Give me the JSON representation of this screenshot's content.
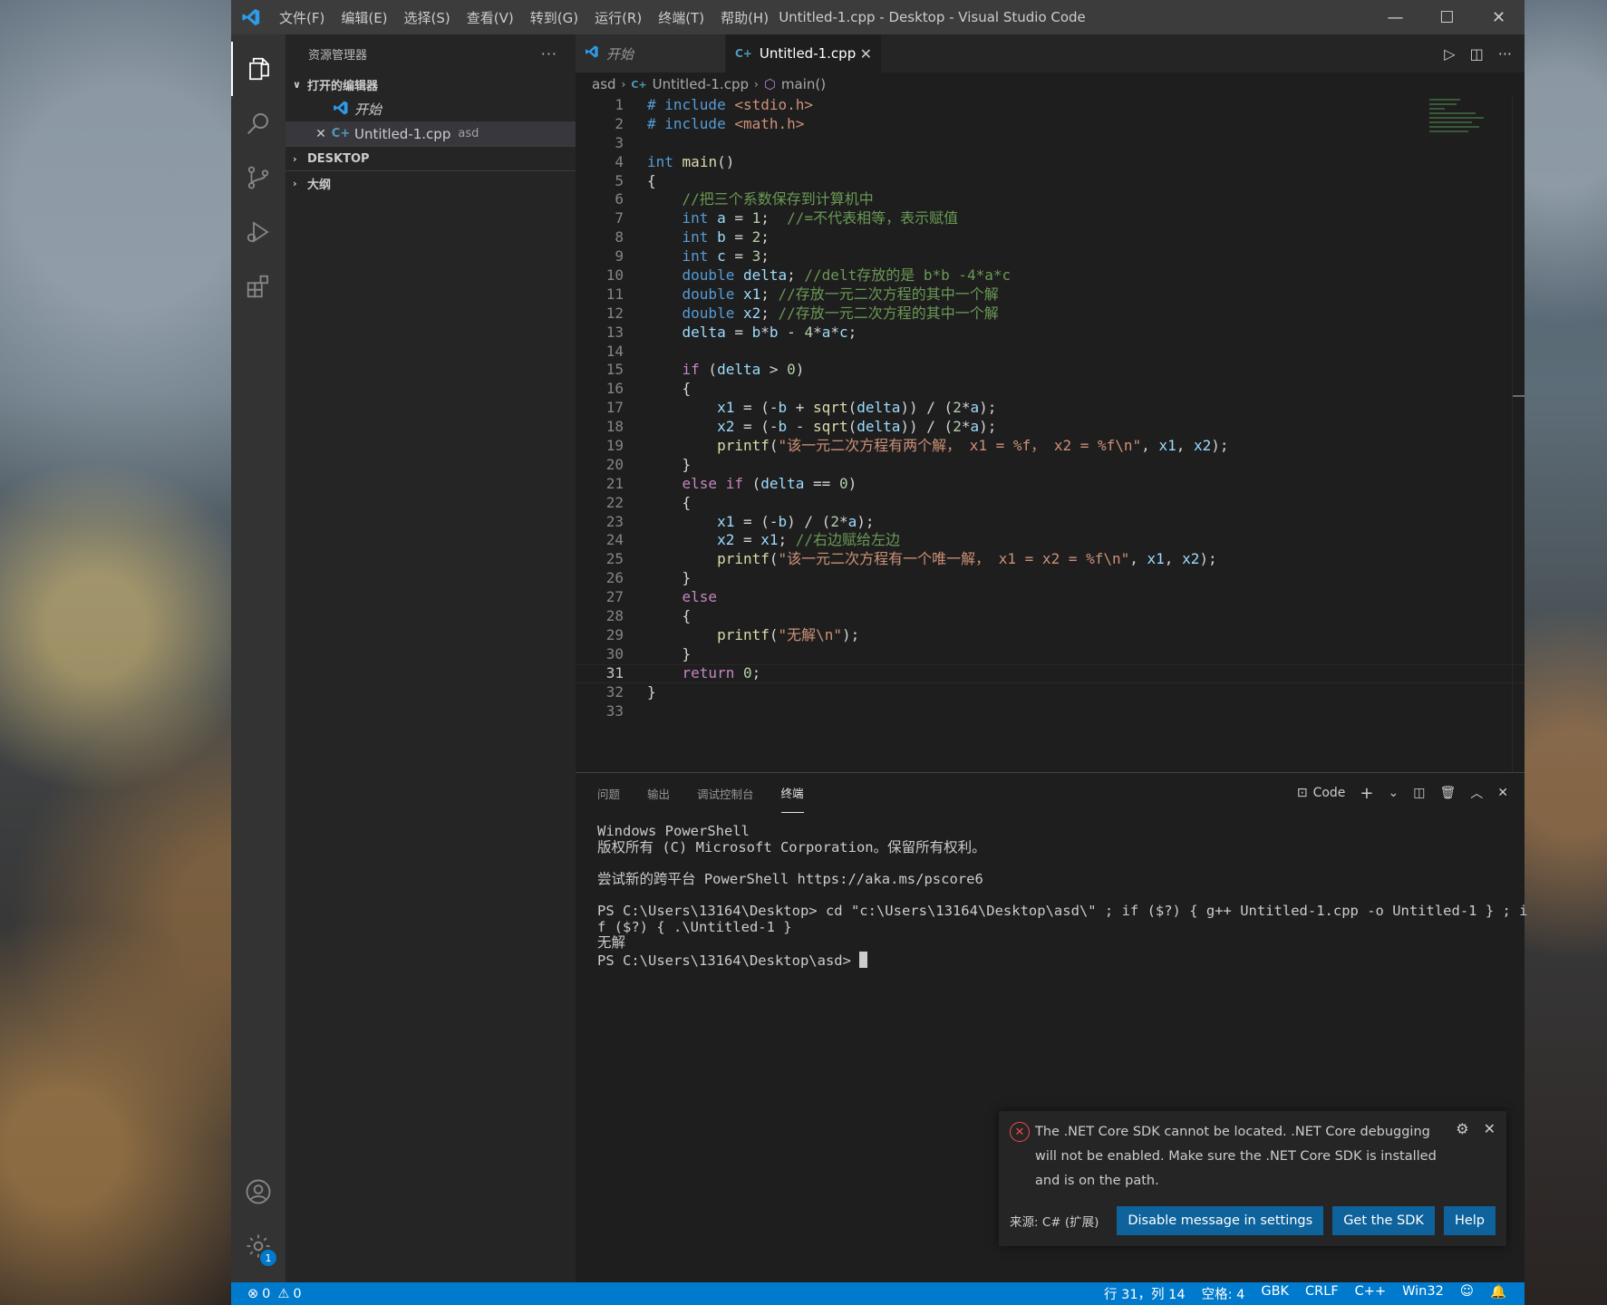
{
  "window": {
    "title": "Untitled-1.cpp - Desktop - Visual Studio Code",
    "menu": [
      "文件(F)",
      "编辑(E)",
      "选择(S)",
      "查看(V)",
      "转到(G)",
      "运行(R)",
      "终端(T)",
      "帮助(H)"
    ],
    "controls": {
      "minimize": "—",
      "maximize": "☐",
      "close": "✕"
    }
  },
  "activity_bar": {
    "items": [
      "explorer-icon",
      "search-icon",
      "source-control-icon",
      "run-debug-icon",
      "extensions-icon"
    ],
    "bottom": [
      "account-icon",
      "manage-gear-icon"
    ],
    "manage_badge": "1"
  },
  "sidebar": {
    "header": "资源管理器",
    "more": "···",
    "open_editors": {
      "label": "打开的编辑器",
      "items": [
        {
          "name": "开始",
          "desc": "",
          "icon": "vscode-icon"
        },
        {
          "name": "Untitled-1.cpp",
          "desc": "asd",
          "icon": "cpp-icon"
        }
      ]
    },
    "sections": [
      "DESKTOP",
      "大纲"
    ]
  },
  "tabs": [
    {
      "label": "开始",
      "active": false
    },
    {
      "label": "Untitled-1.cpp",
      "active": true
    }
  ],
  "breadcrumb": [
    "asd",
    "Untitled-1.cpp",
    "main()"
  ],
  "code": {
    "current_line": 31,
    "lines": [
      "# include <stdio.h>",
      "# include <math.h>",
      "",
      "int main()",
      "{",
      "    //把三个系数保存到计算机中",
      "    int a = 1;  //=不代表相等，表示赋值",
      "    int b = 2;",
      "    int c = 3;",
      "    double delta; //delt存放的是 b*b -4*a*c",
      "    double x1; //存放一元二次方程的其中一个解",
      "    double x2; //存放一元二次方程的其中一个解",
      "    delta = b*b - 4*a*c;",
      "",
      "    if (delta > 0)",
      "    {",
      "        x1 = (-b + sqrt(delta)) / (2*a);",
      "        x2 = (-b - sqrt(delta)) / (2*a);",
      "        printf(\"该一元二次方程有两个解， x1 = %f， x2 = %f\\n\", x1, x2);",
      "    }",
      "    else if (delta == 0)",
      "    {",
      "        x1 = (-b) / (2*a);",
      "        x2 = x1; //右边赋给左边",
      "        printf(\"该一元二次方程有一个唯一解， x1 = x2 = %f\\n\", x1, x2);",
      "    }",
      "    else",
      "    {",
      "        printf(\"无解\\n\");",
      "    }",
      "    return 0;",
      "}",
      ""
    ]
  },
  "panel": {
    "tabs": [
      "问题",
      "输出",
      "调试控制台",
      "终端"
    ],
    "active_tab": "终端",
    "terminal_name": "Code",
    "terminal_lines": [
      "Windows PowerShell",
      "版权所有 (C) Microsoft Corporation。保留所有权利。",
      "",
      "尝试新的跨平台 PowerShell https://aka.ms/pscore6",
      "",
      "PS C:\\Users\\13164\\Desktop> cd \"c:\\Users\\13164\\Desktop\\asd\\\" ; if ($?) { g++ Untitled-1.cpp -o Untitled-1 } ; i",
      "f ($?) { .\\Untitled-1 }",
      "无解",
      "PS C:\\Users\\13164\\Desktop\\asd> "
    ]
  },
  "notification": {
    "message": "The .NET Core SDK cannot be located. .NET Core debugging will not be enabled. Make sure the .NET Core SDK is installed and is on the path.",
    "source": "来源: C# (扩展)",
    "buttons": [
      "Disable message in settings",
      "Get the SDK",
      "Help"
    ]
  },
  "status_bar": {
    "errors": "0",
    "warnings": "0",
    "position": "行 31，列 14",
    "spaces": "空格: 4",
    "encoding": "GBK",
    "eol": "CRLF",
    "language": "C++",
    "platform": "Win32"
  },
  "colors": {
    "accent": "#007acc",
    "titlebar": "#3c3c3c",
    "editor_bg": "#1e1e1e",
    "sidebar_bg": "#252526",
    "activity_bar": "#333333",
    "button": "#0e639c",
    "error": "#f14c4c"
  }
}
